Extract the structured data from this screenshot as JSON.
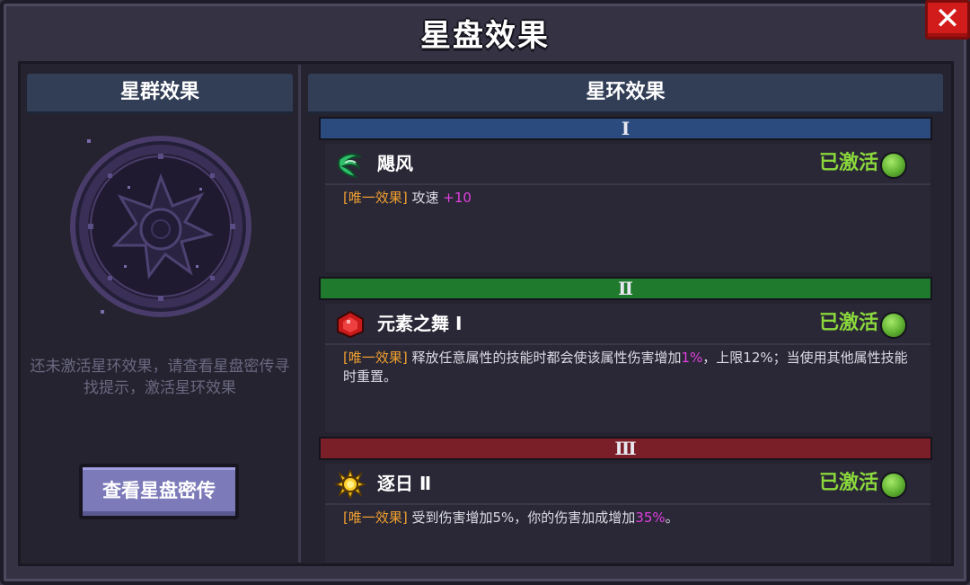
{
  "window": {
    "title": "星盘效果",
    "close_label": "✕"
  },
  "left_panel": {
    "header": "星群效果",
    "hint": "还未激活星环效果，请查看星盘密传寻找提示，激活星环效果",
    "button_label": "查看星盘密传"
  },
  "right_panel": {
    "header": "星环效果",
    "tiers": [
      {
        "numeral": "Ⅰ",
        "color": "#2b4a7e",
        "effect": {
          "name": "飓风",
          "icon": "cyclone-icon",
          "status": "已激活",
          "tag": "[唯一效果]",
          "text_1": " 攻速 ",
          "highlight_1": "+10",
          "text_2": "",
          "highlight_2": "",
          "text_3": ""
        }
      },
      {
        "numeral": "Ⅱ",
        "color": "#1f7a2e",
        "effect": {
          "name": "元素之舞 Ⅰ",
          "icon": "ruby-gem-icon",
          "status": "已激活",
          "tag": "[唯一效果]",
          "text_1": " 释放任意属性的技能时都会使该属性伤害增加",
          "highlight_1": "1%",
          "text_2": "，上限12%；当使用其他属性技能时重置。",
          "highlight_2": "",
          "text_3": ""
        }
      },
      {
        "numeral": "Ⅲ",
        "color": "#7a1e28",
        "effect": {
          "name": "逐日 Ⅱ",
          "icon": "sun-icon",
          "status": "已激活",
          "tag": "[唯一效果]",
          "text_1": " 受到伤害增加5%，你的伤害加成增加",
          "highlight_1": "35%",
          "text_2": "。",
          "highlight_2": "",
          "text_3": ""
        }
      }
    ]
  },
  "colors": {
    "accent_status": "#8ad83c",
    "tag": "#f0a030",
    "highlight": "#e040e0",
    "button": "#7c7ab8"
  }
}
